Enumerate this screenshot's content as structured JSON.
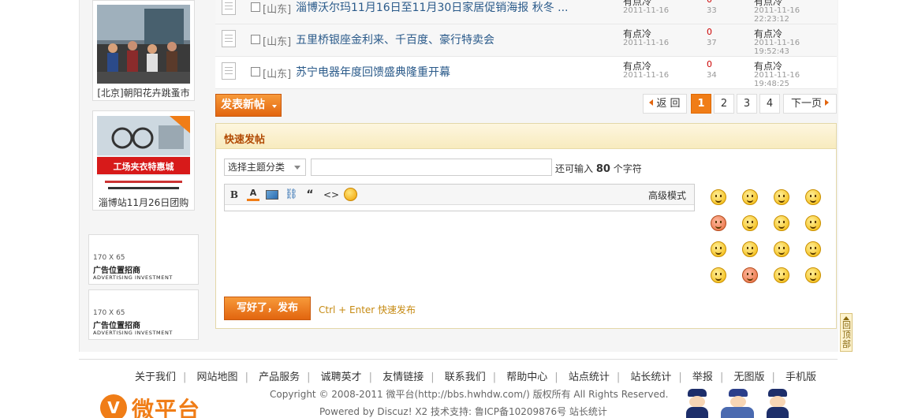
{
  "sidebar": {
    "photos": [
      {
        "caption": "[北京]朝阳花卉跳蚤市"
      },
      {
        "caption": "淄博站11月26日团购",
        "banner": "工场夹衣特惠城"
      }
    ],
    "ads": [
      {
        "size": "170 X 65",
        "title": "广告位置招商",
        "subtitle": "ADVERTISING INVESTMENT"
      },
      {
        "size": "170 X 65",
        "title": "广告位置招商",
        "subtitle": "ADVERTISING INVESTMENT"
      }
    ]
  },
  "threads": [
    {
      "region": "[山东]",
      "title": "淄博沃尔玛11月16日至11月30日家居促销海报 秋冬 ...",
      "author": "有点冷",
      "date": "2011-11-16",
      "replies": "0",
      "views": "33",
      "last_user": "有点冷",
      "last_time": "2011-11-16 22:23:12"
    },
    {
      "region": "[山东]",
      "title": "五里桥银座金利来、千百度、豪行特卖会",
      "author": "有点冷",
      "date": "2011-11-16",
      "replies": "0",
      "views": "37",
      "last_user": "有点冷",
      "last_time": "2011-11-16 19:52:43"
    },
    {
      "region": "[山东]",
      "title": "苏宁电器年度回馈盛典隆重开幕",
      "author": "有点冷",
      "date": "2011-11-16",
      "replies": "0",
      "views": "34",
      "last_user": "有点冷",
      "last_time": "2011-11-16 19:48:25"
    }
  ],
  "new_post_button": "发表新帖",
  "pagination": {
    "prev": "返 回",
    "pages": [
      "1",
      "2",
      "3",
      "4"
    ],
    "current": "1",
    "next": "下一页"
  },
  "quick_post": {
    "header": "快速发帖",
    "category_select": "选择主题分类",
    "remaining_prefix": "还可输入",
    "remaining_count": "80",
    "remaining_suffix": "个字符",
    "toolbar": {
      "bold": "B",
      "color": "A",
      "quote": "“",
      "code": "<>",
      "advanced": "高级模式"
    },
    "submit": "写好了，发布",
    "hint": "Ctrl + Enter 快速发布"
  },
  "back_to_top": "回顶部",
  "footer": {
    "links": [
      "关于我们",
      "网站地图",
      "产品服务",
      "诚聘英才",
      "友情链接",
      "联系我们",
      "帮助中心",
      "站点统计",
      "站长统计",
      "举报",
      "无图版",
      "手机版"
    ],
    "copyright": "Copyright © 2008-2011 微平台(http://bbs.hwhdw.com/) 版权所有 All Rights Reserved.",
    "powered": "Powered by Discuz! X2  技术支持: 鲁ICP备10209876号 站长统计",
    "logo_text": "微平台",
    "logo_mark": "V"
  },
  "colors": {
    "accent": "#f07d17",
    "link": "#2a5a8a",
    "header_bg": "#fdf6df",
    "hint": "#c68a12"
  }
}
